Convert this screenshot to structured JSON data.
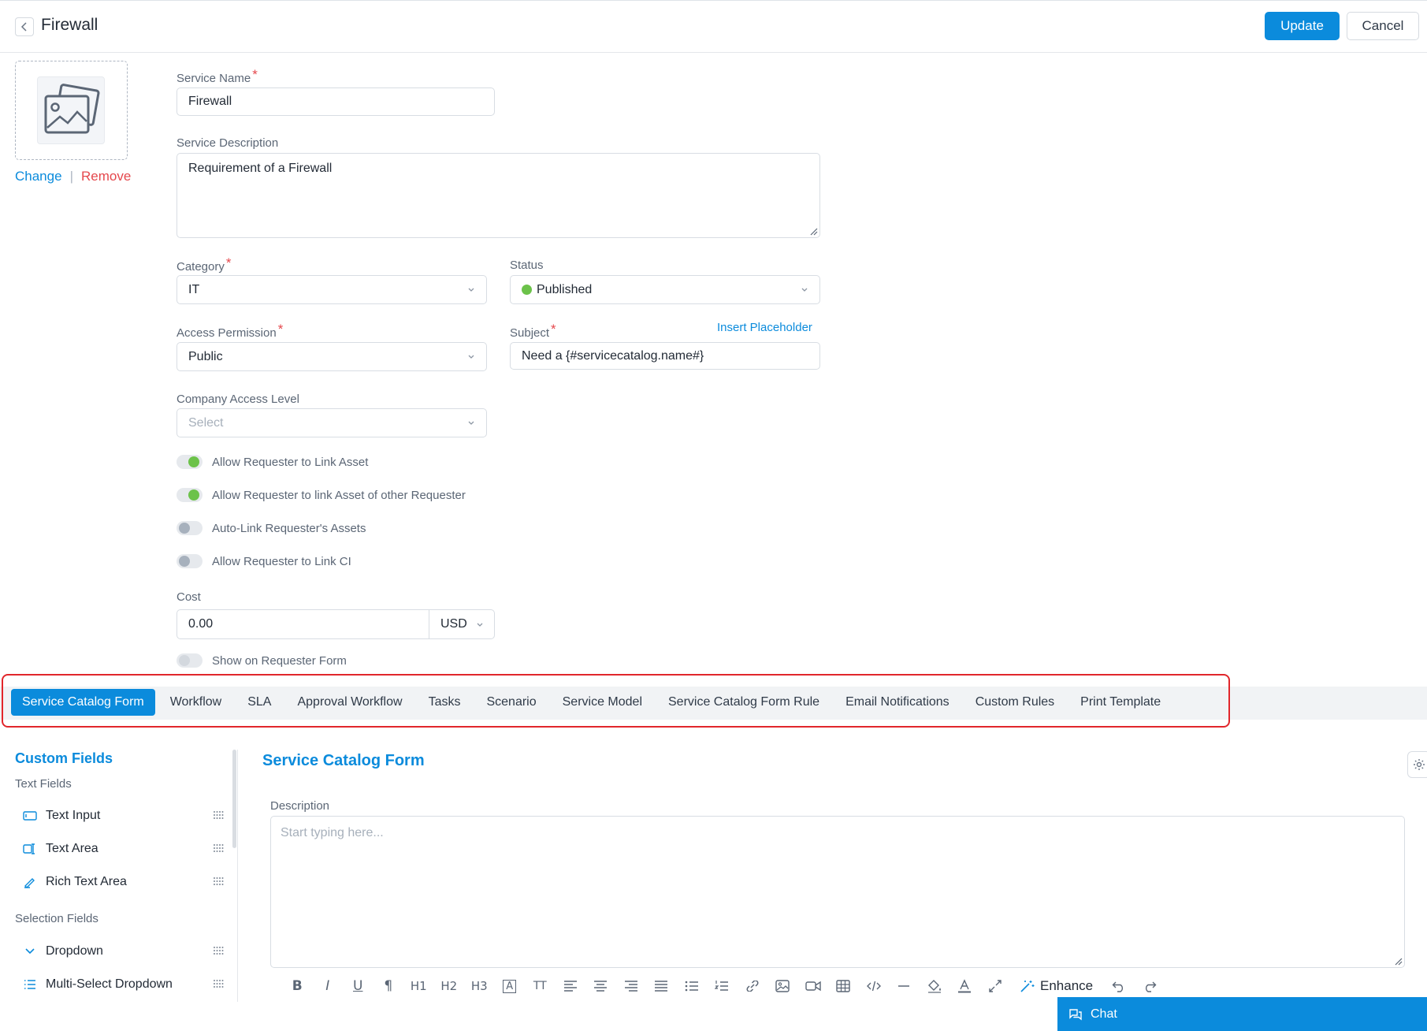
{
  "header": {
    "title": "Firewall",
    "update_label": "Update",
    "cancel_label": "Cancel"
  },
  "image": {
    "change_label": "Change",
    "separator": "|",
    "remove_label": "Remove"
  },
  "form": {
    "service_name": {
      "label": "Service Name",
      "required": "*",
      "value": "Firewall"
    },
    "service_description": {
      "label": "Service Description",
      "value": "Requirement of a Firewall"
    },
    "category": {
      "label": "Category",
      "required": "*",
      "value": "IT"
    },
    "status": {
      "label": "Status",
      "value": "Published",
      "dot_color": "#6cc24a"
    },
    "access_permission": {
      "label": "Access Permission",
      "required": "*",
      "value": "Public"
    },
    "subject": {
      "label": "Subject",
      "required": "*",
      "value": "Need a {#servicecatalog.name#}",
      "insert_placeholder": "Insert Placeholder"
    },
    "company_access_level": {
      "label": "Company Access Level",
      "placeholder": "Select"
    },
    "toggles": [
      {
        "label": "Allow Requester to Link Asset",
        "state": "on"
      },
      {
        "label": "Allow Requester to link Asset of other Requester",
        "state": "on"
      },
      {
        "label": "Auto-Link Requester's Assets",
        "state": "off"
      },
      {
        "label": "Allow Requester to Link CI",
        "state": "off"
      }
    ],
    "cost": {
      "label": "Cost",
      "value": "0.00",
      "currency": "USD"
    },
    "show_on_requester_form": {
      "label": "Show on Requester Form",
      "state": "disabled"
    }
  },
  "tabs": [
    {
      "label": "Service Catalog Form",
      "active": true
    },
    {
      "label": "Workflow"
    },
    {
      "label": "SLA"
    },
    {
      "label": "Approval Workflow"
    },
    {
      "label": "Tasks"
    },
    {
      "label": "Scenario"
    },
    {
      "label": "Service Model"
    },
    {
      "label": "Service Catalog Form Rule"
    },
    {
      "label": "Email Notifications"
    },
    {
      "label": "Custom Rules"
    },
    {
      "label": "Print Template"
    }
  ],
  "custom_fields": {
    "title": "Custom Fields",
    "text_section": "Text Fields",
    "text_items": [
      {
        "label": "Text Input",
        "icon": "text-input-icon"
      },
      {
        "label": "Text Area",
        "icon": "text-area-icon"
      },
      {
        "label": "Rich Text Area",
        "icon": "rich-text-icon"
      }
    ],
    "selection_section": "Selection Fields",
    "selection_items": [
      {
        "label": "Dropdown",
        "icon": "chevron-down-icon"
      },
      {
        "label": "Multi-Select Dropdown",
        "icon": "list-icon"
      }
    ]
  },
  "catalog_form": {
    "title": "Service Catalog Form",
    "description_label": "Description",
    "description_placeholder": "Start typing here...",
    "toolbar": [
      "B",
      "I",
      "U",
      "¶",
      "H1",
      "H2",
      "H3",
      "A",
      "TT",
      "align-left",
      "align-center",
      "align-right",
      "justify",
      "bullet-list",
      "numbered-list",
      "link",
      "image",
      "video",
      "table",
      "code",
      "hr",
      "fill",
      "font-color",
      "fullscreen"
    ],
    "enhance_label": "Enhance"
  },
  "chat": {
    "label": "Chat"
  },
  "colors": {
    "accent": "#0b8bdc",
    "required": "#e5484d",
    "toggle_on": "#6cc24a",
    "highlight": "#e1262b"
  }
}
